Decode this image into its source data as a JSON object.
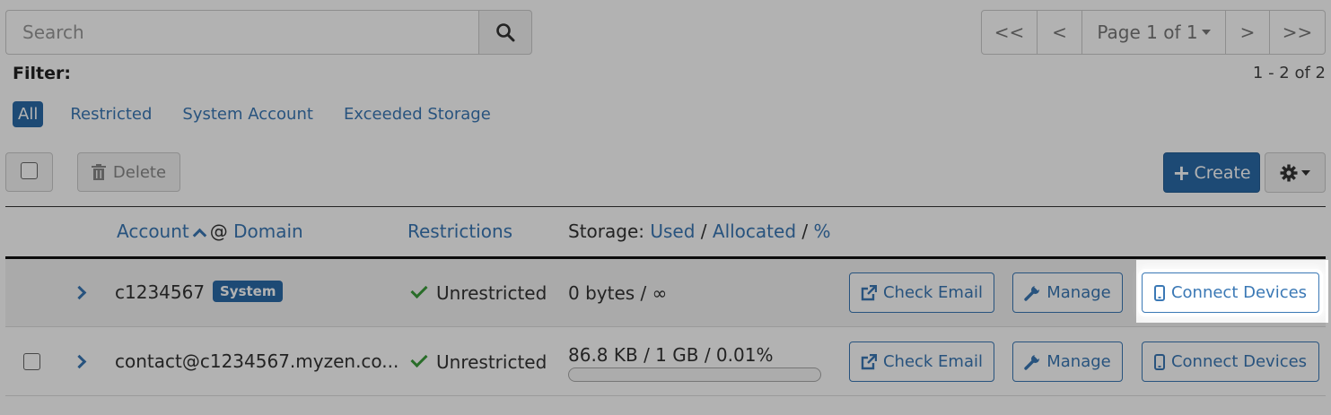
{
  "search": {
    "placeholder": "Search"
  },
  "pagination": {
    "first": "<<",
    "prev": "<",
    "page_label": "Page 1 of 1",
    "next": ">",
    "last": ">>"
  },
  "filter": {
    "label": "Filter:",
    "count": "1 - 2 of 2",
    "options": [
      "All",
      "Restricted",
      "System Account",
      "Exceeded Storage"
    ],
    "active": "All"
  },
  "toolbar": {
    "delete_label": "Delete",
    "create_label": "Create"
  },
  "table": {
    "headers": {
      "account": "Account",
      "at": "@",
      "domain": "Domain",
      "restrictions": "Restrictions",
      "storage_prefix": "Storage:",
      "used": "Used",
      "slash1": "/",
      "allocated": "Allocated",
      "slash2": "/",
      "percent": "%"
    },
    "rows": [
      {
        "account": "c1234567",
        "badge": "System",
        "restriction": "Unrestricted",
        "storage": "0 bytes / ∞",
        "actions": [
          "Check Email",
          "Manage",
          "Connect Devices"
        ]
      },
      {
        "account": "contact@c1234567.myzen.co...",
        "restriction": "Unrestricted",
        "storage": "86.8 KB / 1 GB / 0.01%",
        "usage_fraction": 0.0001,
        "actions": [
          "Check Email",
          "Manage",
          "Connect Devices"
        ]
      }
    ]
  },
  "colors": {
    "primary": "#2a6aa8",
    "link": "#3a78b5",
    "success": "#3b9c3b"
  }
}
